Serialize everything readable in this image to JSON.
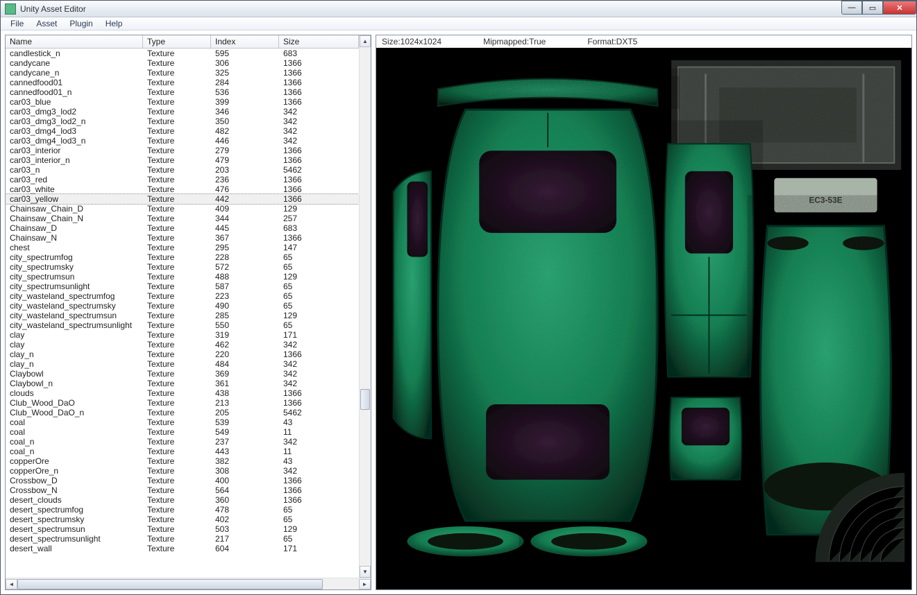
{
  "window": {
    "title": "Unity Asset Editor"
  },
  "menu": {
    "file": "File",
    "asset": "Asset",
    "plugin": "Plugin",
    "help": "Help"
  },
  "table": {
    "headers": {
      "name": "Name",
      "type": "Type",
      "index": "Index",
      "size": "Size"
    },
    "selected": "car03_yellow",
    "rows": [
      {
        "name": "candlestick_n",
        "type": "Texture",
        "idx": "595",
        "size": "683"
      },
      {
        "name": "candycane",
        "type": "Texture",
        "idx": "306",
        "size": "1366"
      },
      {
        "name": "candycane_n",
        "type": "Texture",
        "idx": "325",
        "size": "1366"
      },
      {
        "name": "cannedfood01",
        "type": "Texture",
        "idx": "284",
        "size": "1366"
      },
      {
        "name": "cannedfood01_n",
        "type": "Texture",
        "idx": "536",
        "size": "1366"
      },
      {
        "name": "car03_blue",
        "type": "Texture",
        "idx": "399",
        "size": "1366"
      },
      {
        "name": "car03_dmg3_lod2",
        "type": "Texture",
        "idx": "346",
        "size": "342"
      },
      {
        "name": "car03_dmg3_lod2_n",
        "type": "Texture",
        "idx": "350",
        "size": "342"
      },
      {
        "name": "car03_dmg4_lod3",
        "type": "Texture",
        "idx": "482",
        "size": "342"
      },
      {
        "name": "car03_dmg4_lod3_n",
        "type": "Texture",
        "idx": "446",
        "size": "342"
      },
      {
        "name": "car03_interior",
        "type": "Texture",
        "idx": "279",
        "size": "1366"
      },
      {
        "name": "car03_interior_n",
        "type": "Texture",
        "idx": "479",
        "size": "1366"
      },
      {
        "name": "car03_n",
        "type": "Texture",
        "idx": "203",
        "size": "5462"
      },
      {
        "name": "car03_red",
        "type": "Texture",
        "idx": "236",
        "size": "1366"
      },
      {
        "name": "car03_white",
        "type": "Texture",
        "idx": "476",
        "size": "1366"
      },
      {
        "name": "car03_yellow",
        "type": "Texture",
        "idx": "442",
        "size": "1366"
      },
      {
        "name": "Chainsaw_Chain_D",
        "type": "Texture",
        "idx": "409",
        "size": "129"
      },
      {
        "name": "Chainsaw_Chain_N",
        "type": "Texture",
        "idx": "344",
        "size": "257"
      },
      {
        "name": "Chainsaw_D",
        "type": "Texture",
        "idx": "445",
        "size": "683"
      },
      {
        "name": "Chainsaw_N",
        "type": "Texture",
        "idx": "367",
        "size": "1366"
      },
      {
        "name": "chest",
        "type": "Texture",
        "idx": "295",
        "size": "147"
      },
      {
        "name": "city_spectrumfog",
        "type": "Texture",
        "idx": "228",
        "size": "65"
      },
      {
        "name": "city_spectrumsky",
        "type": "Texture",
        "idx": "572",
        "size": "65"
      },
      {
        "name": "city_spectrumsun",
        "type": "Texture",
        "idx": "488",
        "size": "129"
      },
      {
        "name": "city_spectrumsunlight",
        "type": "Texture",
        "idx": "587",
        "size": "65"
      },
      {
        "name": "city_wasteland_spectrumfog",
        "type": "Texture",
        "idx": "223",
        "size": "65"
      },
      {
        "name": "city_wasteland_spectrumsky",
        "type": "Texture",
        "idx": "490",
        "size": "65"
      },
      {
        "name": "city_wasteland_spectrumsun",
        "type": "Texture",
        "idx": "285",
        "size": "129"
      },
      {
        "name": "city_wasteland_spectrumsunlight",
        "type": "Texture",
        "idx": "550",
        "size": "65"
      },
      {
        "name": "clay",
        "type": "Texture",
        "idx": "319",
        "size": "171"
      },
      {
        "name": "clay",
        "type": "Texture",
        "idx": "462",
        "size": "342"
      },
      {
        "name": "clay_n",
        "type": "Texture",
        "idx": "220",
        "size": "1366"
      },
      {
        "name": "clay_n",
        "type": "Texture",
        "idx": "484",
        "size": "342"
      },
      {
        "name": "Claybowl",
        "type": "Texture",
        "idx": "369",
        "size": "342"
      },
      {
        "name": "Claybowl_n",
        "type": "Texture",
        "idx": "361",
        "size": "342"
      },
      {
        "name": "clouds",
        "type": "Texture",
        "idx": "438",
        "size": "1366"
      },
      {
        "name": "Club_Wood_DaO",
        "type": "Texture",
        "idx": "213",
        "size": "1366"
      },
      {
        "name": "Club_Wood_DaO_n",
        "type": "Texture",
        "idx": "205",
        "size": "5462"
      },
      {
        "name": "coal",
        "type": "Texture",
        "idx": "539",
        "size": "43"
      },
      {
        "name": "coal",
        "type": "Texture",
        "idx": "549",
        "size": "11"
      },
      {
        "name": "coal_n",
        "type": "Texture",
        "idx": "237",
        "size": "342"
      },
      {
        "name": "coal_n",
        "type": "Texture",
        "idx": "443",
        "size": "11"
      },
      {
        "name": "copperOre",
        "type": "Texture",
        "idx": "382",
        "size": "43"
      },
      {
        "name": "copperOre_n",
        "type": "Texture",
        "idx": "308",
        "size": "342"
      },
      {
        "name": "Crossbow_D",
        "type": "Texture",
        "idx": "400",
        "size": "1366"
      },
      {
        "name": "Crossbow_N",
        "type": "Texture",
        "idx": "564",
        "size": "1366"
      },
      {
        "name": "desert_clouds",
        "type": "Texture",
        "idx": "360",
        "size": "1366"
      },
      {
        "name": "desert_spectrumfog",
        "type": "Texture",
        "idx": "478",
        "size": "65"
      },
      {
        "name": "desert_spectrumsky",
        "type": "Texture",
        "idx": "402",
        "size": "65"
      },
      {
        "name": "desert_spectrumsun",
        "type": "Texture",
        "idx": "503",
        "size": "129"
      },
      {
        "name": "desert_spectrumsunlight",
        "type": "Texture",
        "idx": "217",
        "size": "65"
      },
      {
        "name": "desert_wall",
        "type": "Texture",
        "idx": "604",
        "size": "171"
      }
    ]
  },
  "preview": {
    "size_label": "Size:1024x1024",
    "mipmapped_label": "Mipmapped:True",
    "format_label": "Format:DXT5",
    "plate_text": "EC3-53E"
  }
}
